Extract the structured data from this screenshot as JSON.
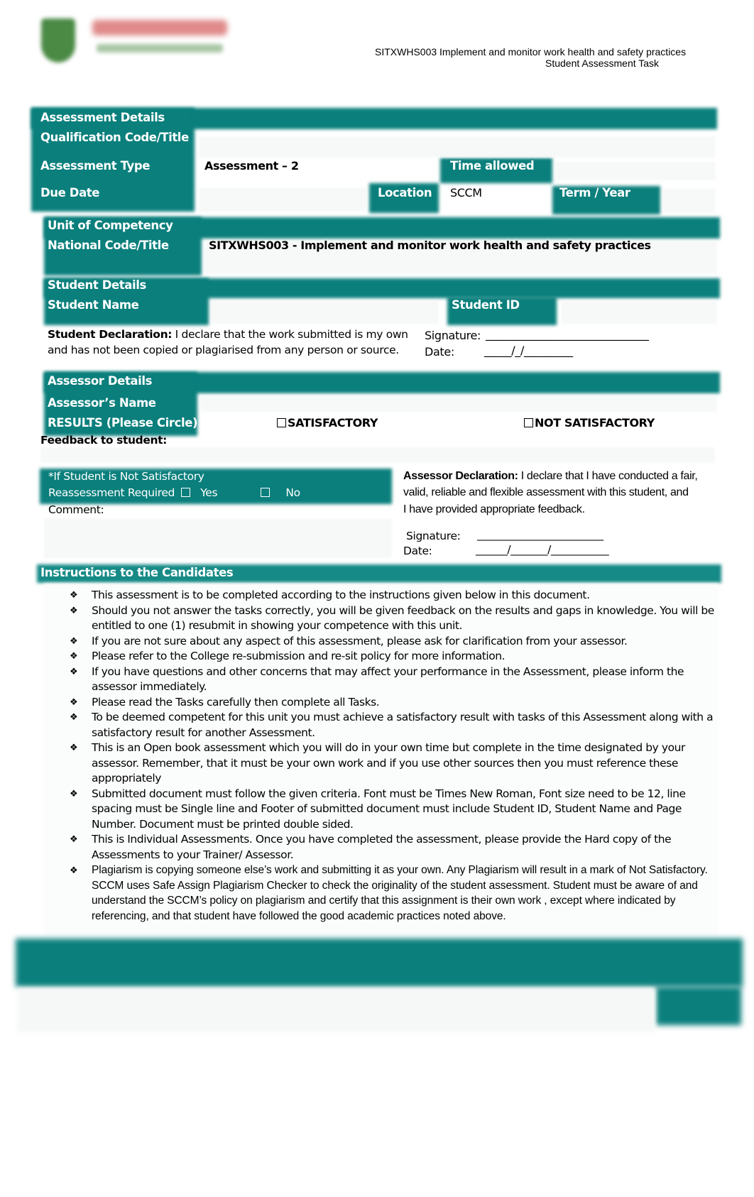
{
  "header": {
    "logo_alt": "college-logo",
    "unit_line": "SITXWHS003 Implement and monitor work health and safety practices",
    "task_line": "Student Assessment Task"
  },
  "assessment": {
    "section_label": "Assessment Details",
    "qualification_label": "Qualification Code/Title",
    "qualification_value": "",
    "type_label": "Assessment Type",
    "type_value": "Assessment – 2",
    "time_allowed_label": "Time allowed",
    "time_allowed_value": "",
    "due_date_label": "Due Date",
    "due_date_value": "",
    "location_label": "Location",
    "location_value": "SCCM",
    "term_year_label": "Term / Year",
    "term_year_value": ""
  },
  "unit": {
    "section_label": "Unit of Competency",
    "code_label": "National Code/Title",
    "code_value": "SITXWHS003 - Implement and monitor work health and safety practices"
  },
  "student": {
    "section_label": "Student Details",
    "name_label": "Student Name",
    "name_value": "",
    "id_label": "Student ID",
    "id_value": "",
    "declaration_bold": "Student Declaration:",
    "declaration_line1": " I declare that the work submitted is my own",
    "declaration_line2": "and has not been copied or plagiarised from any person or source.",
    "signature_label": "Signature:",
    "signature_line": "______________________________",
    "date_label": "Date:",
    "date_line": "_____/_/_________"
  },
  "assessor": {
    "section_label": "Assessor Details",
    "name_label": "Assessor’s Name",
    "name_value": "",
    "results_label": "RESULTS (Please Circle)",
    "result_options": [
      "SATISFACTORY",
      "NOT SATISFACTORY"
    ],
    "feedback_label": "Feedback to student:",
    "reassess_line1": "*If Student is Not Satisfactory",
    "reassess_label": "Reassessment Required",
    "reassess_yes": "Yes",
    "reassess_no": "No",
    "comment_label": "Comment:",
    "declaration_bold": "Assessor Declaration:",
    "declaration_line1": "  I declare that I have conducted a fair,",
    "declaration_line2": "valid, reliable and flexible assessment with this student, and",
    "declaration_line3": "I have provided appropriate feedback.",
    "signature_label": "Signature:",
    "signature_line": "________________________",
    "date_label": "Date:",
    "date_line": "______/_______/___________"
  },
  "instructions": {
    "title": "Instructions to the Candidates",
    "bullet_glyph": "❖",
    "items": [
      "This assessment is to be completed according to the instructions given below in this document.",
      "Should you not answer the tasks correctly, you will be given feedback on the results and gaps in knowledge. You will be entitled to one (1) resubmit in showing your competence with this unit.",
      "If you are not sure about any aspect of this assessment, please ask for clarification from your assessor.",
      "Please refer to the College re-submission and re-sit policy for more information.",
      "If you have questions and other concerns that may affect your performance in the Assessment, please inform the assessor immediately.",
      "Please read the Tasks carefully then complete all Tasks.",
      "To be deemed competent for this unit you must achieve a satisfactory result with tasks of this Assessment along with a satisfactory result for another Assessment.",
      "This is an Open book assessment which you will do in your own time but complete in the time designated by your assessor. Remember, that it must be your own work and if you use other sources then you must reference these appropriately",
      "Submitted document must follow the given criteria. Font must be Times New Roman, Font size need to be 12, line spacing must be Single line and Footer of submitted document must include Student ID, Student Name and Page Number. Document must be printed double sided.",
      "This is Individual Assessments. Once you have completed the assessment, please provide the Hard copy of the Assessments to your Trainer/ Assessor.",
      "Plagiarism is copying someone else’s work and submitting it as your own. Any Plagiarism will result in a mark of Not Satisfactory. SCCM uses Safe Assign Plagiarism Checker to check the originality of the student assessment. Student must be aware of and understand the SCCM’s policy on plagiarism and certify that this assignment is their own work , except where indicated by referencing, and that student have followed the good academic practices noted above."
    ]
  },
  "colors": {
    "teal": "#0a7f7c"
  }
}
